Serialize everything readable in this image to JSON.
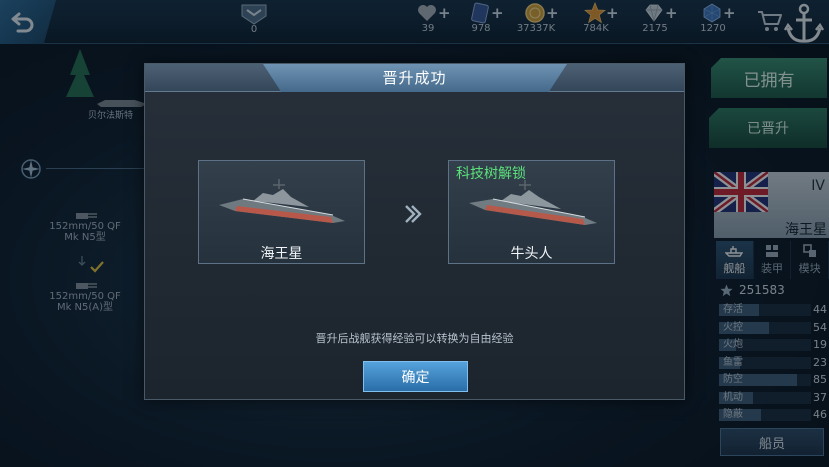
{
  "topbar": {
    "rank_count": "0",
    "resources": [
      {
        "icon": "heart-icon",
        "value": "39"
      },
      {
        "icon": "card-icon",
        "value": "978"
      },
      {
        "icon": "gold-coin-icon",
        "value": "37337K"
      },
      {
        "icon": "star-icon",
        "value": "784K"
      },
      {
        "icon": "diamond-icon",
        "value": "2175"
      },
      {
        "icon": "crystal-icon",
        "value": "1270"
      }
    ],
    "plus": "+"
  },
  "background": {
    "ship_label": "贝尔法斯特",
    "tree_items": [
      {
        "line1": "152mm/50 QF",
        "line2": "Mk N5型"
      },
      {
        "line1": "152mm/50 QF",
        "line2": "Mk N5(A)型"
      }
    ]
  },
  "right_panel": {
    "owned_label": "已拥有",
    "promoted_label": "已晋升",
    "ship_tier": "IV",
    "ship_name": "海王星",
    "tabs": [
      {
        "label": "舰船",
        "icon": "ship-icon",
        "active": true
      },
      {
        "label": "装甲",
        "icon": "armor-icon",
        "active": false
      },
      {
        "label": "模块",
        "icon": "module-icon",
        "active": false
      }
    ],
    "score": "251583",
    "stats": [
      {
        "label": "存活",
        "value": 44
      },
      {
        "label": "火控",
        "value": 54
      },
      {
        "label": "火炮",
        "value": 19
      },
      {
        "label": "鱼雷",
        "value": 23
      },
      {
        "label": "防空",
        "value": 85
      },
      {
        "label": "机动",
        "value": 37
      },
      {
        "label": "隐蔽",
        "value": 46
      }
    ],
    "crew_label": "船员"
  },
  "modal": {
    "title": "晋升成功",
    "from_ship": "海王星",
    "to_ship": "牛头人",
    "unlock_label": "科技树解锁",
    "note": "晋升后战舰获得经验可以转换为自由经验",
    "confirm_label": "确定"
  },
  "colors": {
    "accent_green": "#5ce07a",
    "confirm_blue": "#3b8ac7"
  }
}
